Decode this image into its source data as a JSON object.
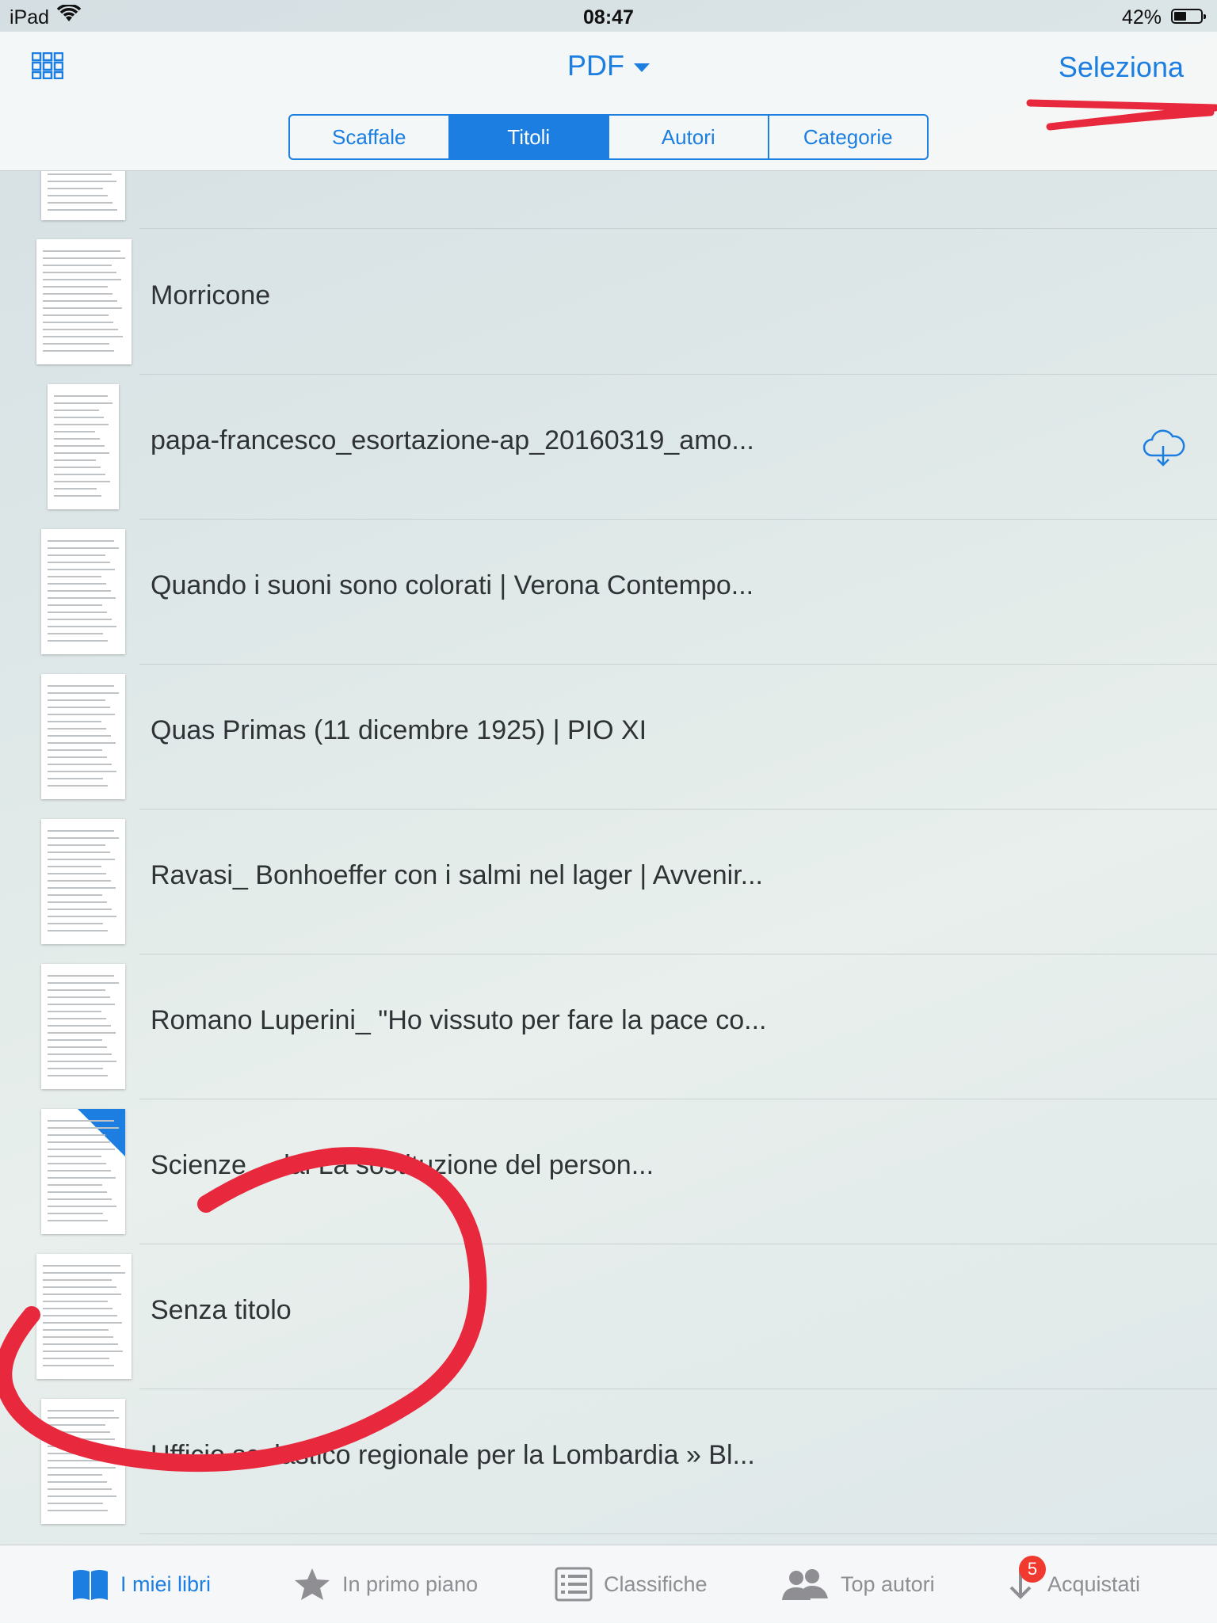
{
  "status_bar": {
    "device": "iPad",
    "time": "08:47",
    "battery": "42%",
    "battery_level": 0.42
  },
  "nav": {
    "title": "PDF",
    "select_label": "Seleziona",
    "segments": [
      "Scaffale",
      "Titoli",
      "Autori",
      "Categorie"
    ],
    "active_segment": "Titoli"
  },
  "books": [
    {
      "title": "",
      "icon": null
    },
    {
      "title": "Morricone",
      "icon": null
    },
    {
      "title": "papa-francesco_esortazione-ap_20160319_amo...",
      "icon": "cloud-download-icon"
    },
    {
      "title": "Quando i suoni sono colorati | Verona Contempo...",
      "icon": null
    },
    {
      "title": "Quas Primas (11 dicembre 1925) | PIO XI",
      "icon": null
    },
    {
      "title": "Ravasi_ Bonhoeffer con i salmi nel lager | Avvenir...",
      "icon": null
    },
    {
      "title": "Romano Luperini_ \"Ho vissuto per fare la pace co...",
      "icon": null
    },
    {
      "title": "Scienze ... lai La sostituzione del person...",
      "icon": null
    },
    {
      "title": "Senza titolo",
      "icon": null
    },
    {
      "title": "Ufficio scolastico regionale per la Lombardia » Bl...",
      "icon": null
    }
  ],
  "tabs": [
    {
      "label": "I miei libri",
      "icon": "book-icon",
      "active": true
    },
    {
      "label": "In primo piano",
      "icon": "star-icon",
      "active": false
    },
    {
      "label": "Classifiche",
      "icon": "list-icon",
      "active": false
    },
    {
      "label": "Top autori",
      "icon": "people-icon",
      "active": false
    },
    {
      "label": "Acquistati",
      "icon": "download-arrow-icon",
      "active": false,
      "badge": "5"
    }
  ],
  "colors": {
    "accent": "#1b7ee0",
    "annotation": "#e8283c",
    "badge": "#f03a30"
  }
}
